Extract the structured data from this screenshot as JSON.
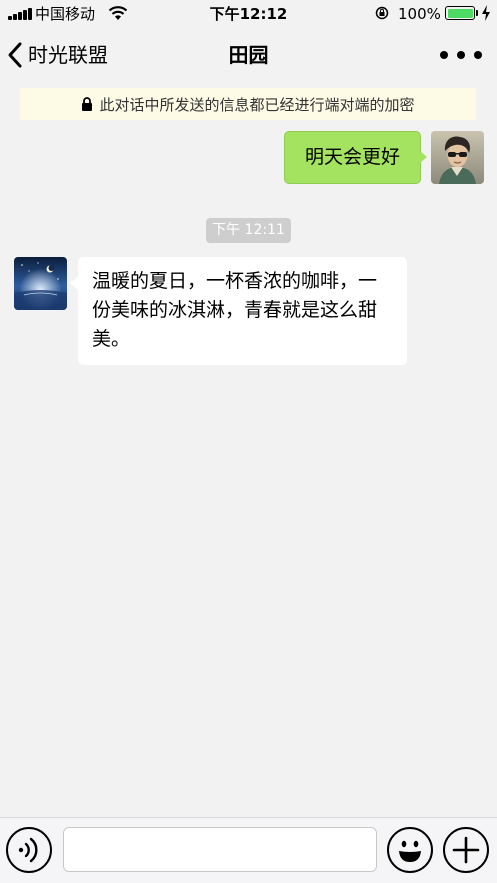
{
  "status_bar": {
    "carrier": "中国移动",
    "time": "下午12:12",
    "battery_percent": "100%",
    "battery_level": 1.0
  },
  "nav": {
    "back_label": "时光联盟",
    "title": "田园",
    "more_icon": "more-icon"
  },
  "notice": {
    "text": "此对话中所发送的信息都已经进行端对端的加密",
    "icon": "lock-icon"
  },
  "messages": [
    {
      "direction": "outgoing",
      "text": "明天会更好"
    },
    {
      "direction": "timestamp",
      "text": "下午 12:11"
    },
    {
      "direction": "incoming",
      "text": "温暖的夏日，一杯香浓的咖啡，一份美味的冰淇淋，青春就是这么甜美。"
    }
  ],
  "input_bar": {
    "voice_icon": "voice-icon",
    "input_value": "",
    "emoji_icon": "emoji-icon",
    "plus_icon": "plus-icon"
  },
  "colors": {
    "outgoing_bubble": "#a3e35f",
    "incoming_bubble": "#ffffff",
    "background": "#f2f2f2",
    "notice_background": "#fdfbe6",
    "battery_fill": "#4cd964"
  }
}
